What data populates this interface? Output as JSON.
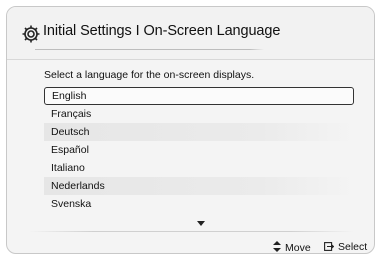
{
  "header": {
    "title": "Initial Settings I On-Screen Language",
    "icon": "gear-icon"
  },
  "prompt": "Select a language for the on-screen displays.",
  "languages": [
    {
      "label": "English",
      "selected": true
    },
    {
      "label": "Français",
      "selected": false
    },
    {
      "label": "Deutsch",
      "selected": false
    },
    {
      "label": "Español",
      "selected": false
    },
    {
      "label": "Italiano",
      "selected": false
    },
    {
      "label": "Nederlands",
      "selected": false
    },
    {
      "label": "Svenska",
      "selected": false
    }
  ],
  "footer": {
    "move_label": "Move",
    "select_label": "Select",
    "move_icon": "up-down-arrows-icon",
    "select_icon": "enter-icon"
  },
  "colors": {
    "selection_border": "#333333",
    "background": "#f4f4f4"
  }
}
